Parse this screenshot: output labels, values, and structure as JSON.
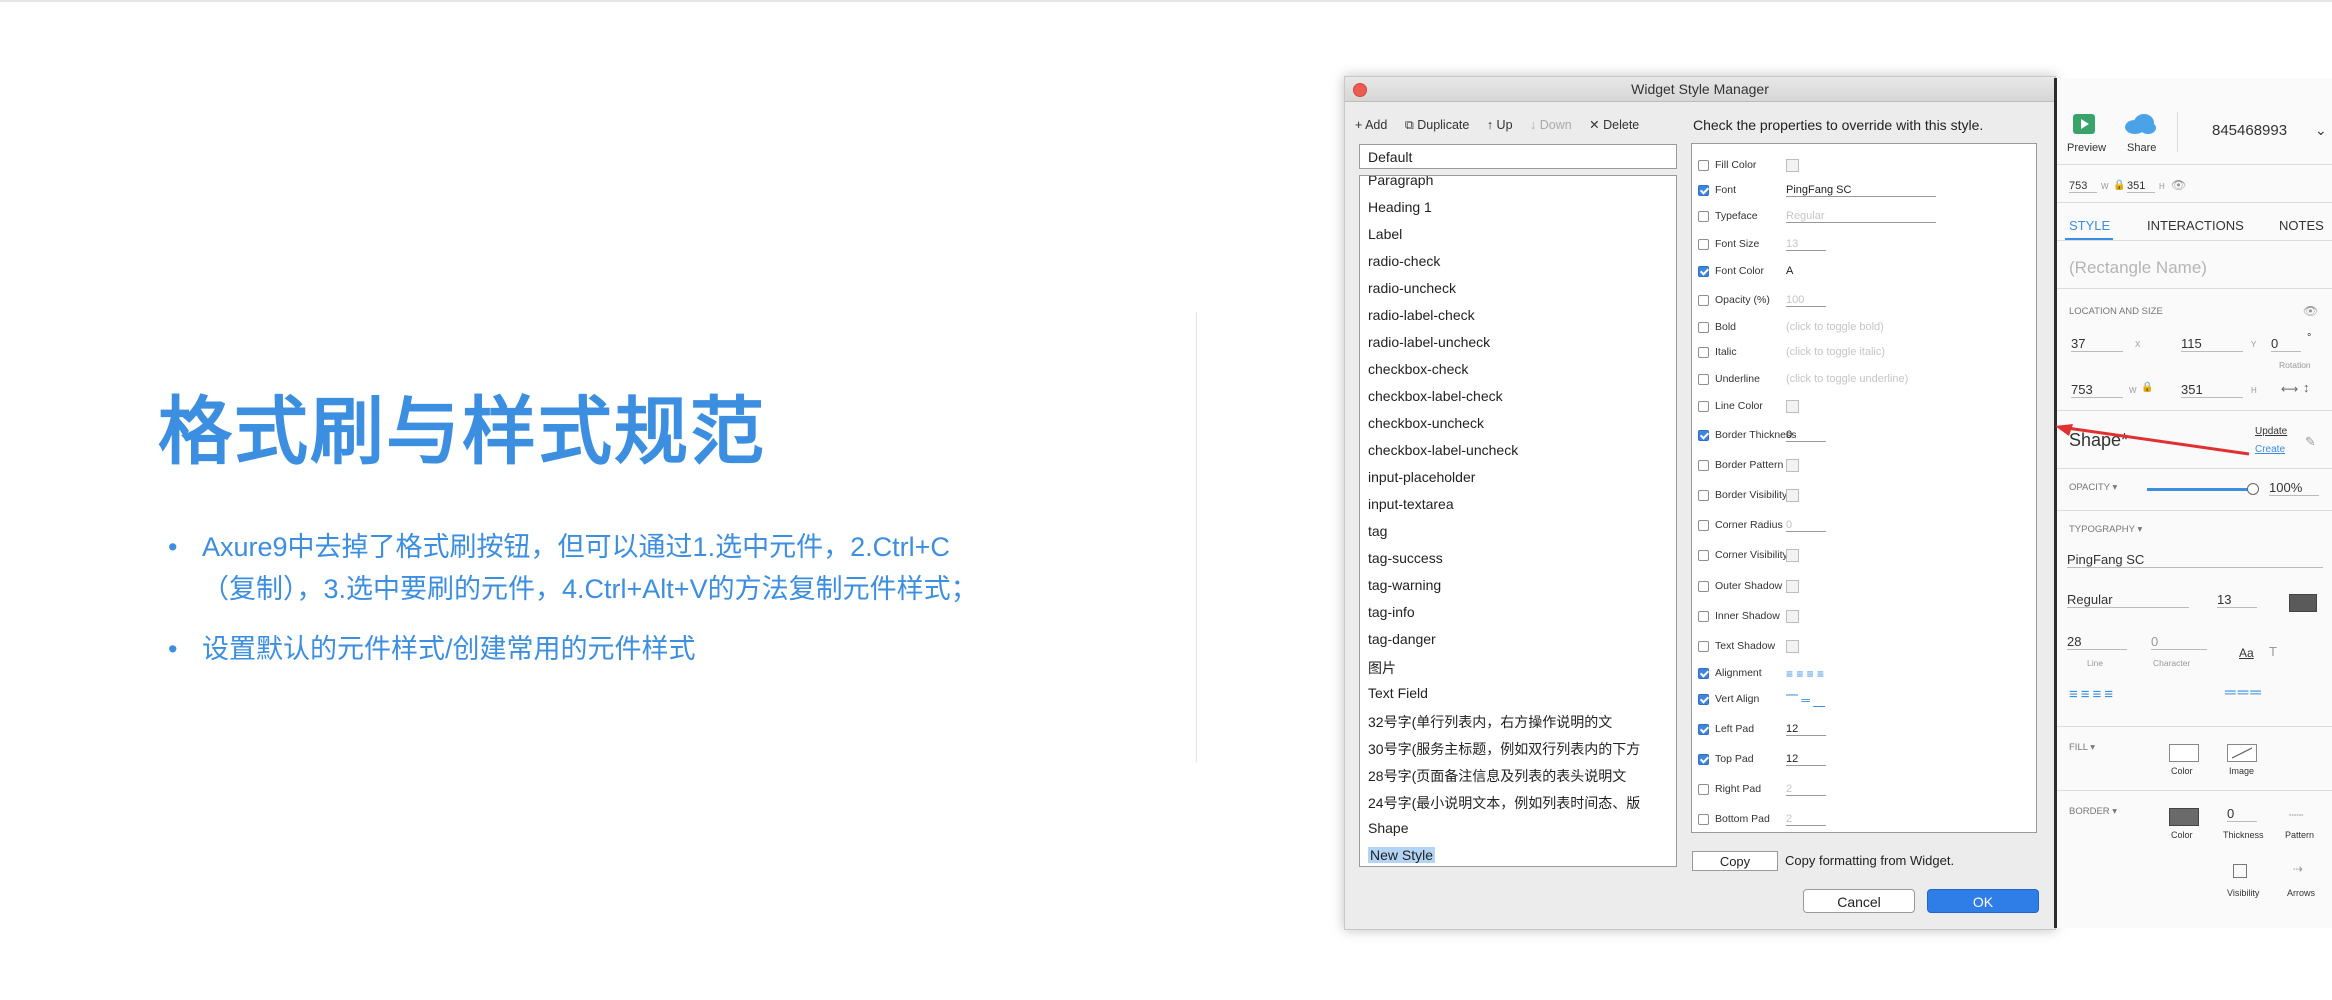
{
  "slide": {
    "title": "格式刷与样式规范",
    "bullet_glyph": "•",
    "bullets": [
      {
        "line1": "Axure9中去掉了格式刷按钮，但可以通过1.选中元件，2.Ctrl+C",
        "line2": "（复制），3.选中要刷的元件，4.Ctrl+Alt+V的方法复制元件样式；"
      },
      {
        "line1": "设置默认的元件样式/创建常用的元件样式",
        "line2": ""
      }
    ]
  },
  "dialog": {
    "title": "Widget Style Manager",
    "toolbar": {
      "add": "+ Add",
      "duplicate": "⧉ Duplicate",
      "up": "↑ Up",
      "down": "↓ Down",
      "delete": "✕ Delete"
    },
    "default_style": "Default",
    "styles": [
      "Paragraph",
      "Heading 1",
      "Label",
      "radio-check",
      "radio-uncheck",
      "radio-label-check",
      "radio-label-uncheck",
      "checkbox-check",
      "checkbox-label-check",
      "checkbox-uncheck",
      "checkbox-label-uncheck",
      "input-placeholder",
      "input-textarea",
      "tag",
      "tag-success",
      "tag-warning",
      "tag-info",
      "tag-danger",
      "图片",
      "Text Field",
      "32号字(单行列表内，右方操作说明的文",
      "30号字(服务主标题，例如双行列表内的下方",
      "28号字(页面备注信息及列表的表头说明文",
      "24号字(最小说明文本，例如列表时间态、版",
      "Shape",
      "New Style"
    ],
    "override_label": "Check the properties to override with this style.",
    "properties": [
      {
        "label": "Fill Color",
        "checked": false,
        "value": ""
      },
      {
        "label": "Font",
        "checked": true,
        "value": "PingFang SC"
      },
      {
        "label": "Typeface",
        "checked": false,
        "value": "Regular"
      },
      {
        "label": "Font Size",
        "checked": false,
        "value": "13"
      },
      {
        "label": "Font Color",
        "checked": true,
        "value": "A"
      },
      {
        "label": "Opacity (%)",
        "checked": false,
        "value": "100"
      },
      {
        "label": "Bold",
        "checked": false,
        "value": "(click to toggle bold)"
      },
      {
        "label": "Italic",
        "checked": false,
        "value": "(click to toggle italic)"
      },
      {
        "label": "Underline",
        "checked": false,
        "value": "(click to toggle underline)"
      },
      {
        "label": "Line Color",
        "checked": false,
        "value": ""
      },
      {
        "label": "Border Thickness",
        "checked": true,
        "value": "0"
      },
      {
        "label": "Border Pattern",
        "checked": false,
        "value": ""
      },
      {
        "label": "Border Visibility",
        "checked": false,
        "value": ""
      },
      {
        "label": "Corner Radius",
        "checked": false,
        "value": "0"
      },
      {
        "label": "Corner Visibility",
        "checked": false,
        "value": ""
      },
      {
        "label": "Outer Shadow",
        "checked": false,
        "value": ""
      },
      {
        "label": "Inner Shadow",
        "checked": false,
        "value": ""
      },
      {
        "label": "Text Shadow",
        "checked": false,
        "value": ""
      },
      {
        "label": "Alignment",
        "checked": true,
        "value": "≡ ≡ ≡ ≡"
      },
      {
        "label": "Vert Align",
        "checked": true,
        "value": "⎺ ═ ⎽"
      },
      {
        "label": "Left Pad",
        "checked": true,
        "value": "12"
      },
      {
        "label": "Top Pad",
        "checked": true,
        "value": "12"
      },
      {
        "label": "Right Pad",
        "checked": false,
        "value": "2"
      },
      {
        "label": "Bottom Pad",
        "checked": false,
        "value": "2"
      }
    ],
    "copy_button": "Copy",
    "copy_text": "Copy formatting from Widget.",
    "cancel": "Cancel",
    "ok": "OK"
  },
  "inspector": {
    "preview": "Preview",
    "share": "Share",
    "account": "845468993",
    "w": "753",
    "h": "351",
    "w_label": "W",
    "h_label": "H",
    "tabs": {
      "style": "STYLE",
      "interactions": "INTERACTIONS",
      "notes": "NOTES"
    },
    "name_placeholder": "(Rectangle Name)",
    "loc_header": "LOCATION AND SIZE",
    "x": "37",
    "y": "115",
    "rotation": "0",
    "rotation_label": "Rotation",
    "x_label": "X",
    "y_label": "Y",
    "shape_label": "Shape*",
    "update": "Update",
    "create": "Create",
    "opacity_label": "OPACITY ▾",
    "opacity": "100%",
    "opacity_level": 1.0,
    "typography_label": "TYPOGRAPHY ▾",
    "font": "PingFang SC",
    "weight": "Regular",
    "size": "13",
    "line": "28",
    "line_label": "Line",
    "character": "0",
    "character_label": "Character",
    "fill_label": "FILL ▾",
    "fill_color": "Color",
    "fill_image": "Image",
    "border_label": "BORDER ▾",
    "border_color": "Color",
    "border_thickness": "0",
    "thickness_label": "Thickness",
    "pattern_label": "Pattern",
    "visibility_label": "Visibility",
    "arrows_label": "Arrows"
  },
  "colors": {
    "accent": "#3b8ee0",
    "ok_button": "#2f7ee8",
    "arrow": "#e03030",
    "preview_green": "#3aa36a",
    "share_blue": "#4aa3e8"
  }
}
